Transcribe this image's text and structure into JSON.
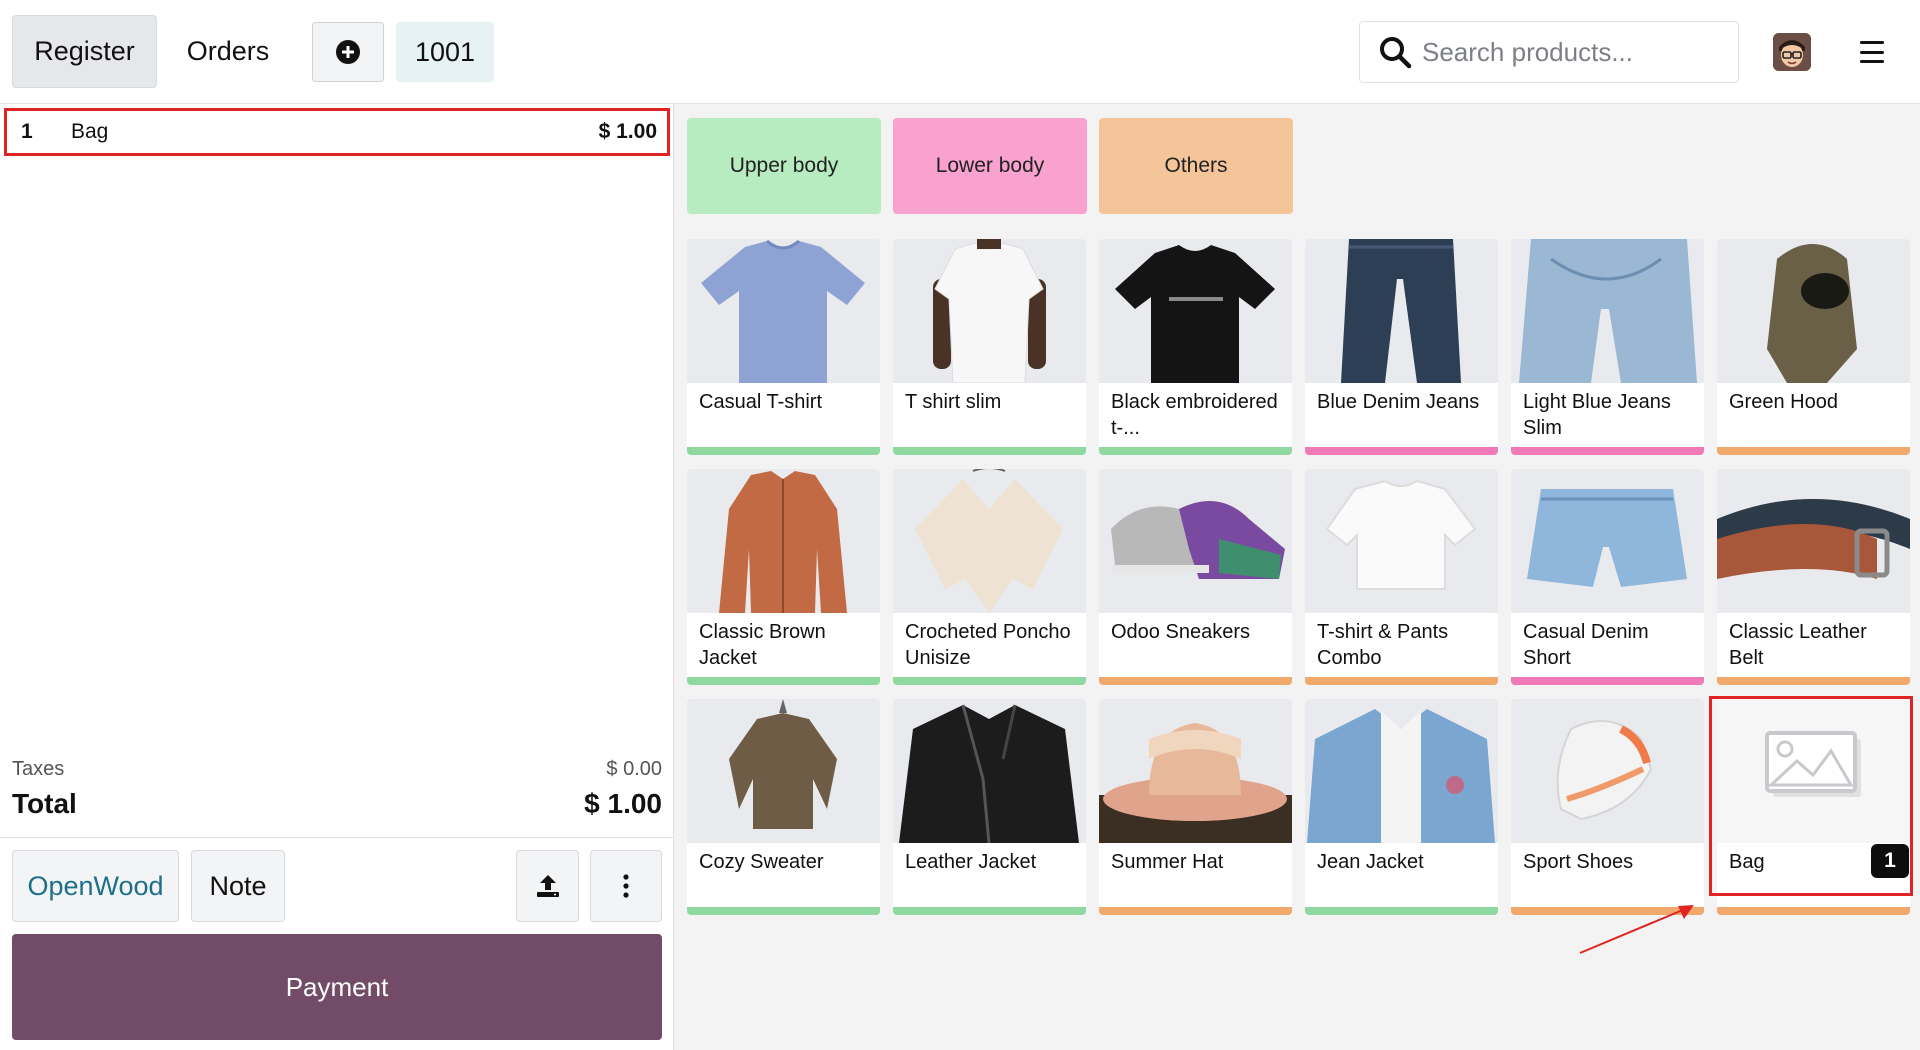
{
  "header": {
    "register_label": "Register",
    "orders_label": "Orders",
    "order_number": "1001",
    "search_placeholder": "Search products..."
  },
  "order": {
    "lines": [
      {
        "qty": "1",
        "name": "Bag",
        "price": "$ 1.00"
      }
    ],
    "taxes_label": "Taxes",
    "taxes_value": "$ 0.00",
    "total_label": "Total",
    "total_value": "$ 1.00"
  },
  "actions": {
    "customer_label": "OpenWood",
    "note_label": "Note",
    "payment_label": "Payment"
  },
  "categories": [
    {
      "label": "Upper body",
      "color": "#b7ebc0"
    },
    {
      "label": "Lower body",
      "color": "#f9a1cf"
    },
    {
      "label": "Others",
      "color": "#f5c59a"
    }
  ],
  "category_colors": {
    "upper": "#8fd9a0",
    "lower": "#f07ab8",
    "others": "#f0a96b"
  },
  "products": [
    {
      "name": "Casual T-shirt",
      "category": "upper",
      "icon": "tshirt-blue-icon"
    },
    {
      "name": "T shirt slim",
      "category": "upper",
      "icon": "tshirt-white-icon"
    },
    {
      "name": "Black embroidered t-...",
      "category": "upper",
      "icon": "tshirt-black-icon"
    },
    {
      "name": "Blue Denim Jeans",
      "category": "lower",
      "icon": "jeans-dark-icon"
    },
    {
      "name": "Light Blue Jeans Slim",
      "category": "lower",
      "icon": "jeans-light-icon"
    },
    {
      "name": "Green Hood",
      "category": "others",
      "icon": "hood-icon"
    },
    {
      "name": "Classic Brown Jacket",
      "category": "upper",
      "icon": "jacket-brown-icon"
    },
    {
      "name": "Crocheted Poncho Unisize",
      "category": "upper",
      "icon": "poncho-icon"
    },
    {
      "name": "Odoo Sneakers",
      "category": "others",
      "icon": "sneaker-icon"
    },
    {
      "name": "T-shirt & Pants Combo",
      "category": "others",
      "icon": "combo-icon"
    },
    {
      "name": "Casual Denim Short",
      "category": "lower",
      "icon": "shorts-icon"
    },
    {
      "name": "Classic Leather Belt",
      "category": "others",
      "icon": "belt-icon"
    },
    {
      "name": "Cozy Sweater",
      "category": "upper",
      "icon": "sweater-icon"
    },
    {
      "name": "Leather Jacket",
      "category": "upper",
      "icon": "leather-jacket-icon"
    },
    {
      "name": "Summer Hat",
      "category": "others",
      "icon": "hat-icon"
    },
    {
      "name": "Jean Jacket",
      "category": "upper",
      "icon": "jean-jacket-icon"
    },
    {
      "name": "Sport Shoes",
      "category": "others",
      "icon": "sport-shoe-icon"
    },
    {
      "name": "Bag",
      "category": "others",
      "icon": "image-placeholder-icon",
      "badge": "1"
    }
  ]
}
